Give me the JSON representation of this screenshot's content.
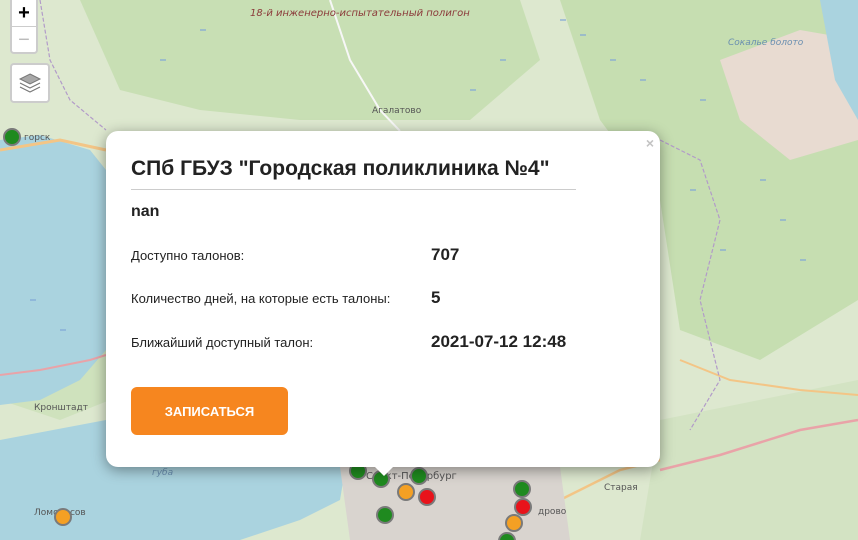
{
  "map": {
    "labels": {
      "polygon": "18-й инженерно-испытательный полигон",
      "agalatovo": "Агалатово",
      "sokolye": "Сокалье болото",
      "zelenogorsk": "горск",
      "kronshtadt": "Кронштадт",
      "guba": "губа",
      "lomonosov": "Ломоносов",
      "spb": "Санкт-Петербург",
      "staraya": "Старая",
      "kudrovo": "дрово"
    },
    "marker_colors": {
      "green": "#1f8a1f",
      "orange": "#f4a024",
      "red": "#e8131b"
    }
  },
  "controls": {
    "zoom_in": "+",
    "zoom_out": "−",
    "layers_icon": "layers-icon"
  },
  "popup": {
    "close": "×",
    "title": "СПб ГБУЗ \"Городская поликлиника №4\"",
    "subtitle": "nan",
    "rows": [
      {
        "label": "Доступно талонов:",
        "value": "707"
      },
      {
        "label": "Количество дней, на которые есть талоны:",
        "value": "5"
      },
      {
        "label": "Ближайший доступный талон:",
        "value": "2021-07-12 12:48"
      }
    ],
    "button": "ЗАПИСАТЬСЯ",
    "accent_color": "#f6861f"
  }
}
